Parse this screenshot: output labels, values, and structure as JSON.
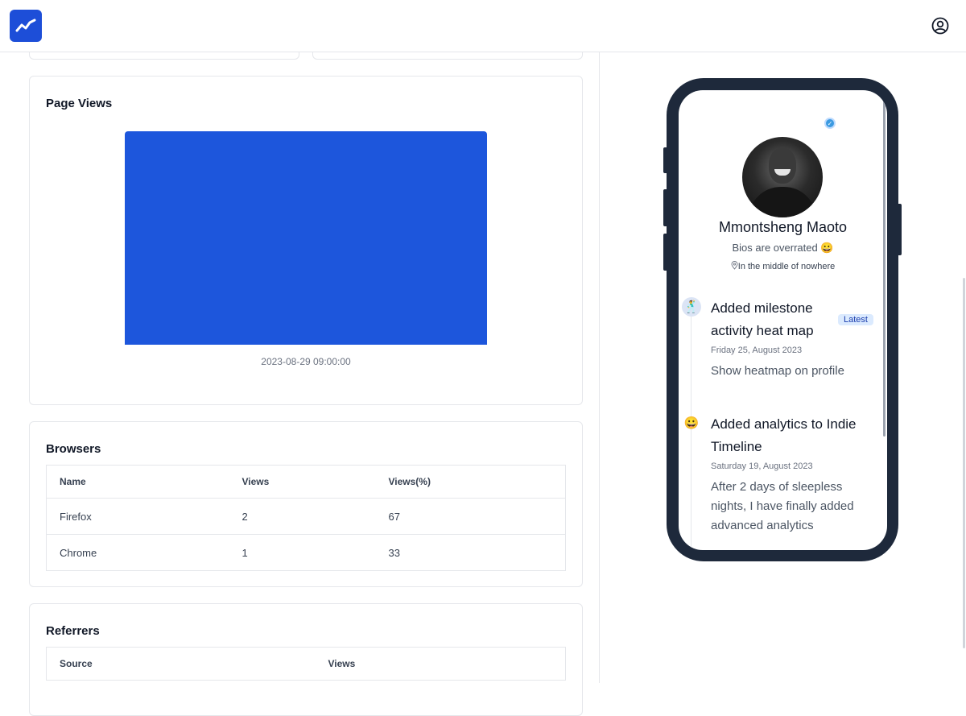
{
  "header": {
    "logo_icon": "trend-line-icon",
    "user_icon": "user-circle-icon"
  },
  "page_views": {
    "title": "Page Views",
    "chart_data": {
      "type": "bar",
      "categories": [
        "2023-08-29 09:00:00"
      ],
      "series": [
        {
          "values": [
            1
          ]
        }
      ],
      "title": "",
      "xlabel": "",
      "ylabel": "",
      "grid": false
    }
  },
  "browsers": {
    "title": "Browsers",
    "columns": [
      "Name",
      "Views",
      "Views(%)"
    ],
    "rows": [
      [
        "Firefox",
        "2",
        "67"
      ],
      [
        "Chrome",
        "1",
        "33"
      ]
    ]
  },
  "referrers": {
    "title": "Referrers",
    "columns": [
      "Source",
      "Views"
    ]
  },
  "profile": {
    "name": "Mmontsheng Maoto",
    "bio": "Bios are overrated 😀",
    "location": "In the middle of nowhere",
    "verified_icon": "verified-check-icon"
  },
  "timeline": [
    {
      "icon": "🕺",
      "title_line1": "Added milestone",
      "title_line2": "activity heat map",
      "badge": "Latest",
      "date": "Friday 25, August 2023",
      "desc": "Show heatmap on profile"
    },
    {
      "icon": "😀",
      "title_line1": "Added analytics to Indie",
      "title_line2": "Timeline",
      "date": "Saturday 19, August 2023",
      "desc_line1": "After 2 days of sleepless",
      "desc_line2": "nights, I have finally added",
      "desc_line3": "advanced  analytics"
    }
  ],
  "colors": {
    "accent": "#1d4ed8",
    "bar": "#1d56dc",
    "phone_frame": "#1e293b",
    "badge_bg": "#dbeafe"
  }
}
